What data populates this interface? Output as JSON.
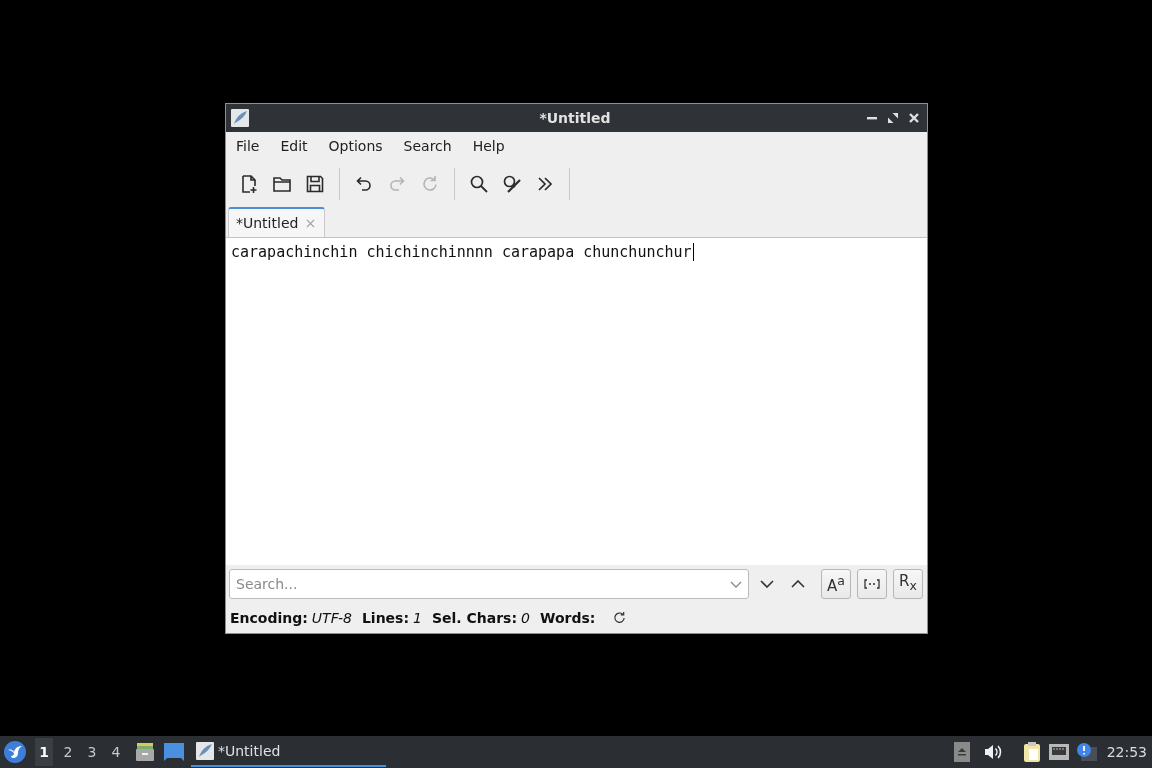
{
  "window": {
    "title": "*Untitled"
  },
  "menu": [
    "File",
    "Edit",
    "Options",
    "Search",
    "Help"
  ],
  "toolbar": {
    "groups": [
      [
        {
          "disabled": false
        },
        {
          "disabled": false
        },
        {
          "disabled": false
        }
      ],
      [
        {
          "disabled": false
        },
        {
          "disabled": true
        },
        {
          "disabled": true
        }
      ],
      [
        {
          "disabled": false
        },
        {
          "disabled": false
        },
        {
          "disabled": false
        }
      ]
    ]
  },
  "tabs": [
    {
      "label": "*Untitled",
      "selected": true
    }
  ],
  "editor": {
    "text": "carapachinchin chichinchinnnn carapapa chunchunchur"
  },
  "search": {
    "placeholder": "Search...",
    "options": [
      {
        "kind": "text",
        "label": "A$^{a}$"
      },
      {
        "kind": "icon"
      },
      {
        "kind": "text",
        "label": "R$_{x}$"
      }
    ]
  },
  "status_bar": {
    "items": [
      {
        "label": "Encoding:",
        "value": "UTF-8"
      },
      {
        "label": "Lines:",
        "value": "1"
      },
      {
        "label": "Sel. Chars:",
        "value": "0"
      },
      {
        "label": "Words:"
      }
    ]
  },
  "taskbar": {
    "workspaces": [
      {
        "label": "1",
        "selected": true
      },
      {
        "label": "2",
        "selected": false
      },
      {
        "label": "3",
        "selected": false
      },
      {
        "label": "4",
        "selected": false
      }
    ],
    "tasks": [
      {
        "label": "*Untitled",
        "selected": true
      }
    ],
    "clock": "22:53"
  }
}
